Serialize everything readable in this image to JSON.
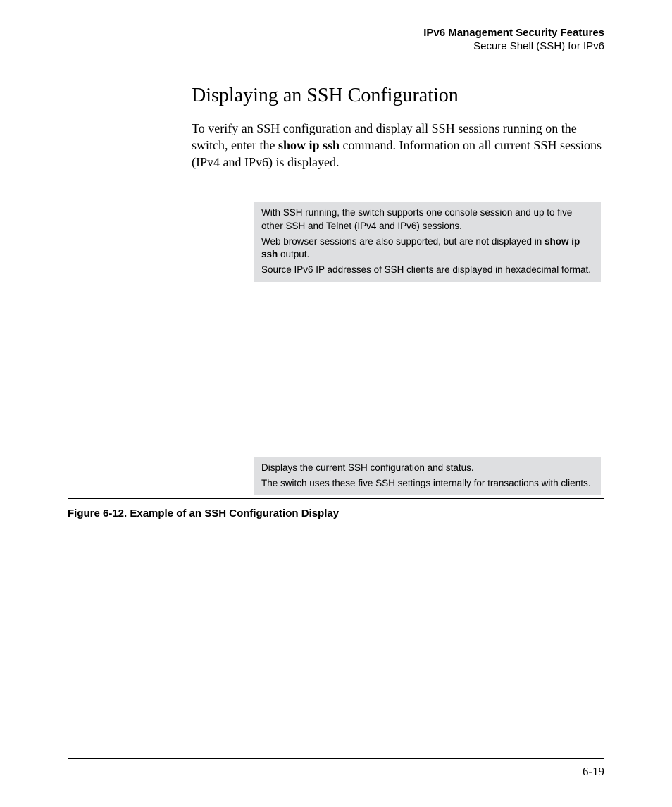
{
  "header": {
    "title_bold": "IPv6 Management Security Features",
    "subtitle": "Secure Shell (SSH) for IPv6"
  },
  "section": {
    "title": "Displaying an SSH Configuration",
    "para_pre": "To verify an SSH configuration and display all SSH sessions running on the switch, enter the ",
    "para_cmd": "show ip ssh",
    "para_post": " command. Information on all current SSH sessions (IPv4 and IPv6) is displayed."
  },
  "callout_top": {
    "line1": "With SSH running, the switch supports one console session and up to five other SSH and Telnet (IPv4 and IPv6) sessions.",
    "line2_pre": "Web browser sessions are also supported, but are not displayed in ",
    "line2_bold": "show ip ssh",
    "line2_post": " output.",
    "line3": "Source IPv6 IP addresses of SSH clients are displayed in hexadecimal format."
  },
  "callout_bottom": {
    "line1": "Displays the current SSH configuration and status.",
    "line2": "The switch uses these five SSH settings internally for transactions with clients."
  },
  "figure_caption": "Figure 6-12.  Example of an SSH Configuration Display",
  "page_number": "6-19"
}
